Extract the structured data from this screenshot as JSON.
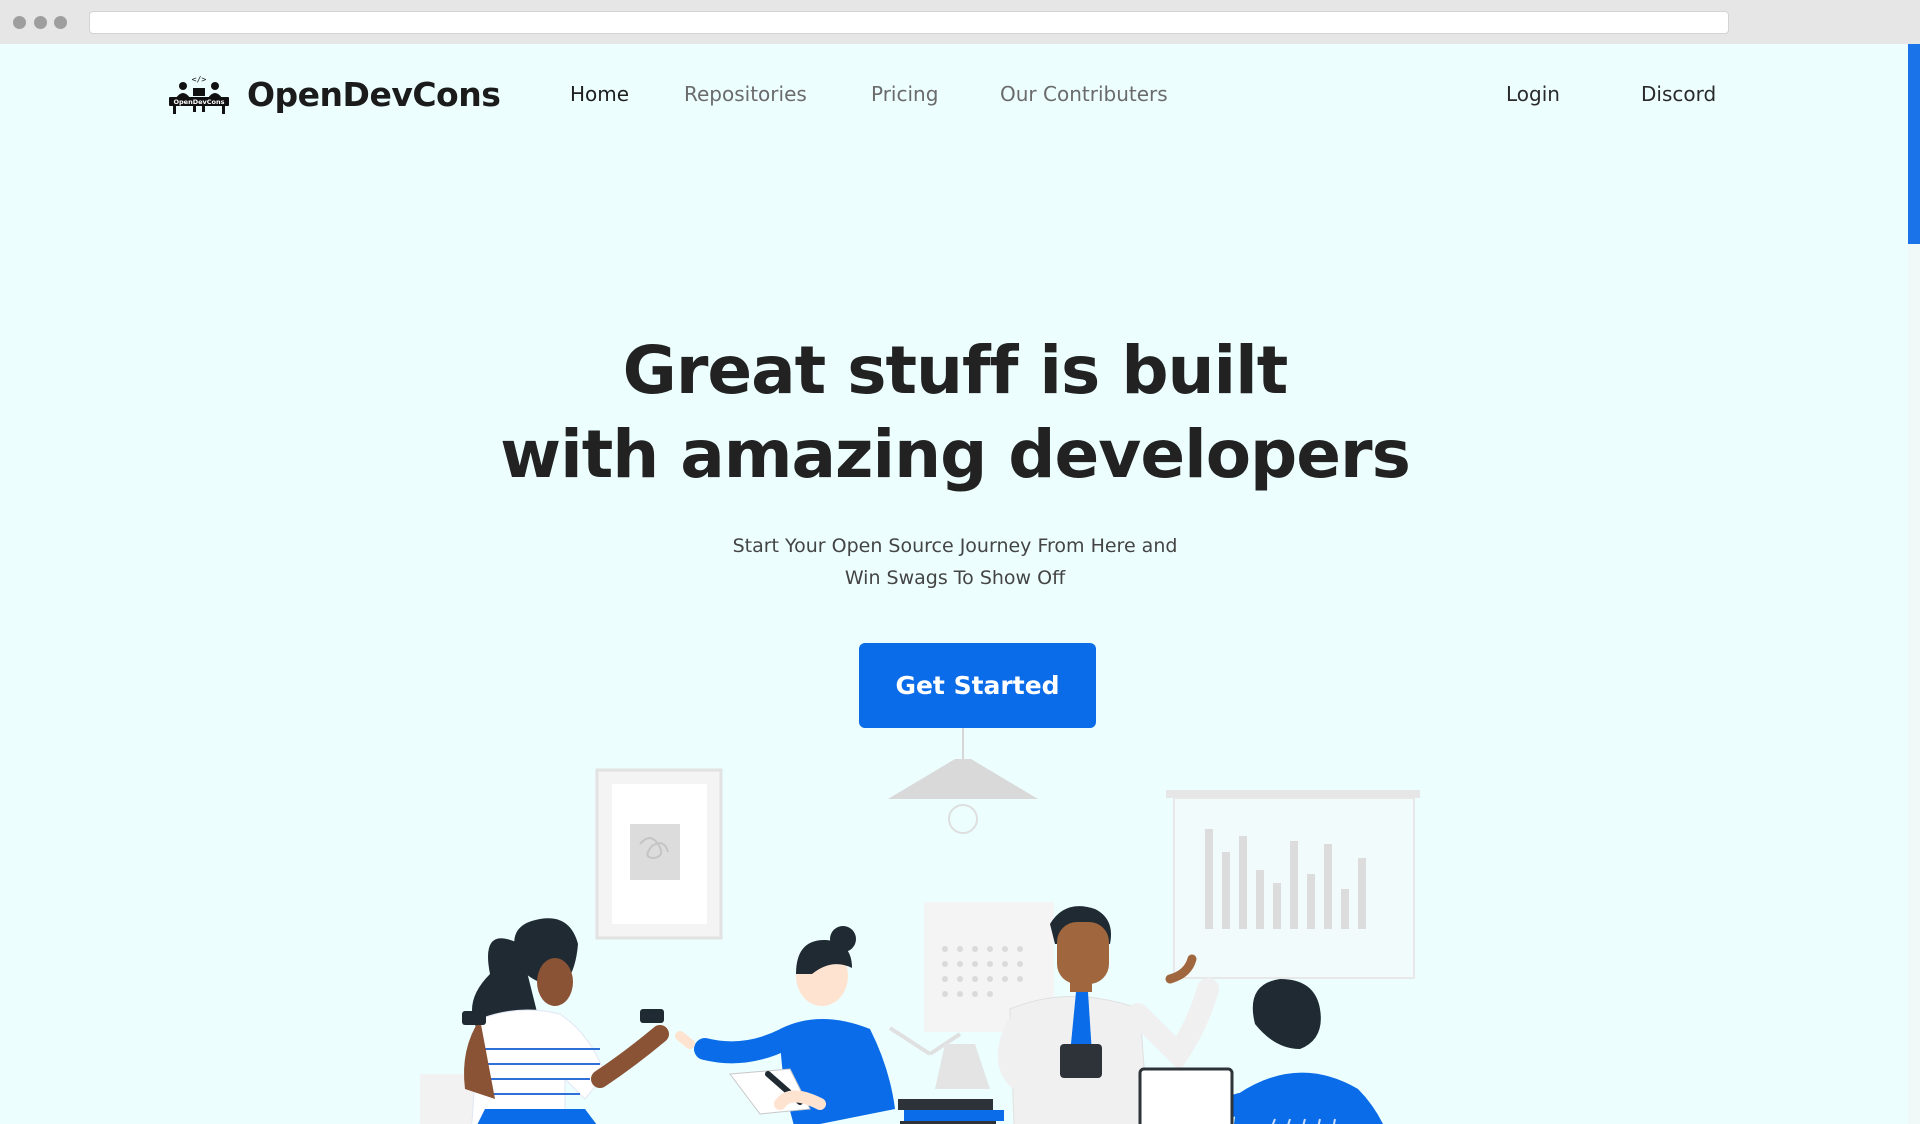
{
  "brand": {
    "name": "OpenDevCons",
    "logo_text": "OpenDevCons",
    "logo_code_glyph": "</>"
  },
  "nav": {
    "links": [
      {
        "label": "Home",
        "active": true
      },
      {
        "label": "Repositories",
        "active": false
      },
      {
        "label": "Pricing",
        "active": false
      },
      {
        "label": "Our Contributers",
        "active": false
      }
    ],
    "login": "Login",
    "discord": "Discord"
  },
  "hero": {
    "title_line1": "Great stuff is built",
    "title_line2": "with amazing developers",
    "subtitle_line1": "Start Your Open Source Journey From Here and",
    "subtitle_line2": "Win Swags To Show Off",
    "cta": "Get Started"
  },
  "colors": {
    "page_bg": "#ecfefe",
    "accent": "#0a6ce9",
    "text_dark": "#222222",
    "text_muted": "#6b6b6b"
  },
  "illustration": {
    "name": "team-collaboration-illustration"
  }
}
